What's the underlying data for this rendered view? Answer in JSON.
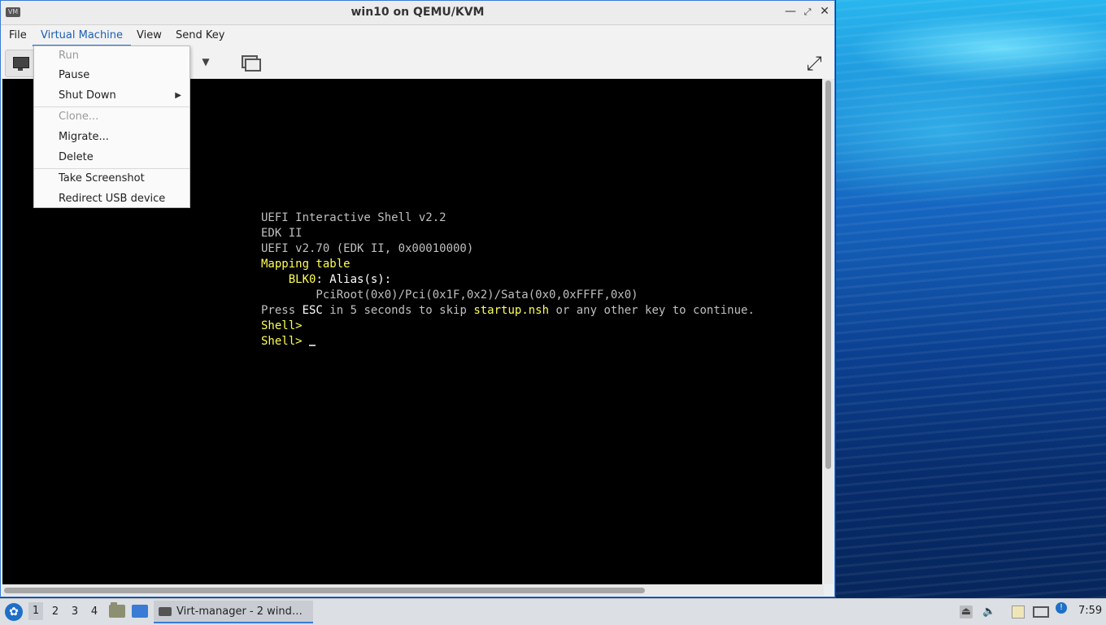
{
  "window": {
    "title": "win10 on QEMU/KVM",
    "icon": "virt-manager-icon",
    "controls": [
      "minimize",
      "maximize",
      "close"
    ]
  },
  "menubar": {
    "items": [
      "File",
      "Virtual Machine",
      "View",
      "Send Key"
    ],
    "active": "Virtual Machine"
  },
  "vm_menu": {
    "items": [
      {
        "label": "Run",
        "enabled": false
      },
      {
        "label": "Pause",
        "enabled": true
      },
      {
        "label": "Shut Down",
        "enabled": true,
        "submenu": true
      },
      {
        "label": "Clone...",
        "enabled": false
      },
      {
        "label": "Migrate...",
        "enabled": true
      },
      {
        "label": "Delete",
        "enabled": true
      },
      {
        "label": "Take Screenshot",
        "enabled": true
      },
      {
        "label": "Redirect USB device",
        "enabled": true
      }
    ]
  },
  "toolbar": {
    "icons": [
      "monitor-icon",
      "dropdown-arrow-icon",
      "screens-icon",
      "fullscreen-icon"
    ]
  },
  "console": {
    "line1": "UEFI Interactive Shell v2.2",
    "line2": "EDK II",
    "line3": "UEFI v2.70 (EDK II, 0x00010000)",
    "line4": "Mapping table",
    "line5_indent": "    ",
    "line5_dev": "BLK0",
    "line5_rest": ": Alias(s):",
    "line6": "        PciRoot(0x0)/Pci(0x1F,0x2)/Sata(0x0,0xFFFF,0x0)",
    "line7_a": "Press ",
    "line7_esc": "ESC",
    "line7_b": " in 5 seconds to skip ",
    "line7_file": "startup.nsh",
    "line7_c": " or any other key to continue.",
    "prompt1": "Shell>",
    "prompt2": "Shell> "
  },
  "taskbar": {
    "workspaces": [
      "1",
      "2",
      "3",
      "4"
    ],
    "active_workspace": "1",
    "task_label": "Virt-manager - 2 wind…",
    "clock": "7:59"
  },
  "colors": {
    "accent": "#3a7bd5",
    "console_bg": "#000000",
    "console_text": "#bfbfbf",
    "console_highlight": "#ffff55"
  }
}
